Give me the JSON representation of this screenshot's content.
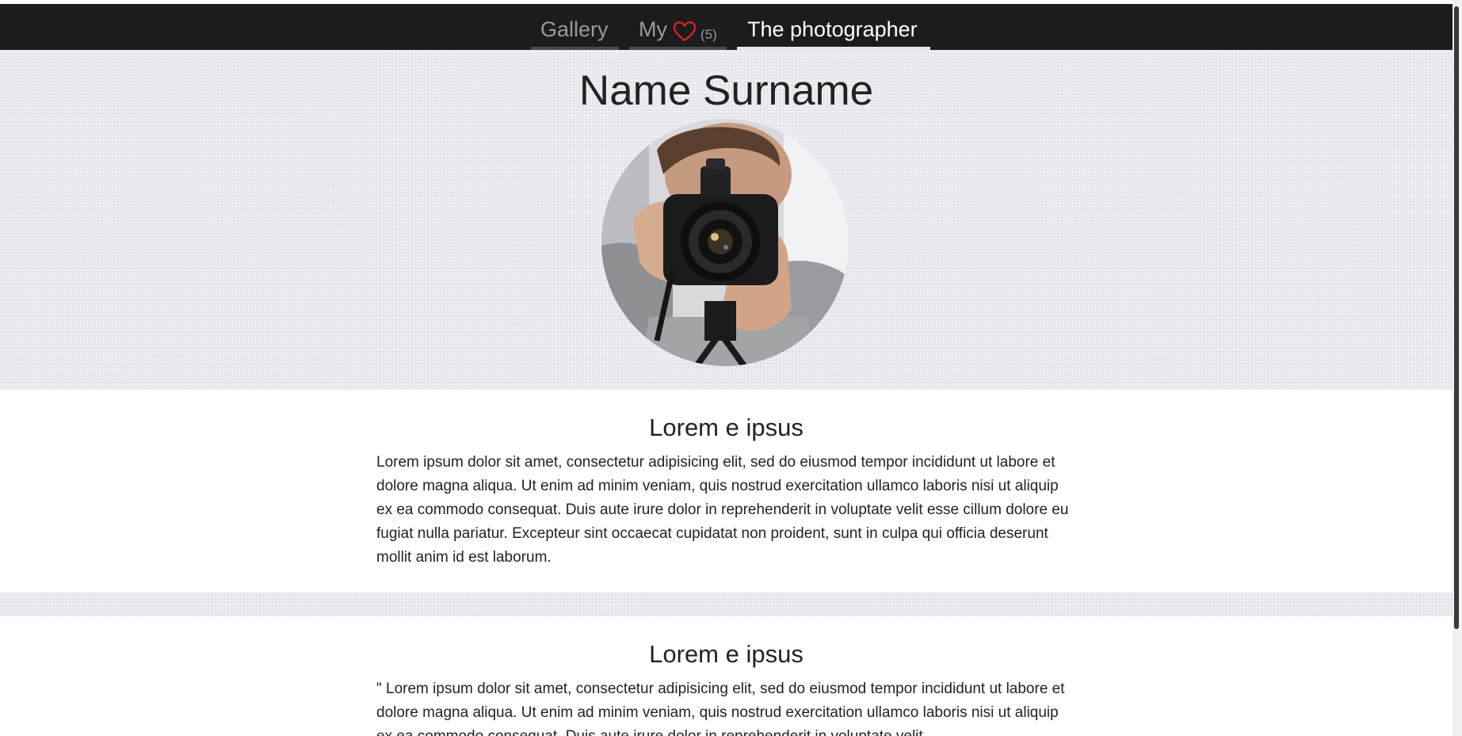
{
  "nav": {
    "items": [
      {
        "label": "Gallery",
        "active": false
      },
      {
        "label": "My",
        "active": false,
        "count": "(5)",
        "icon": "heart-icon"
      },
      {
        "label": "The photographer",
        "active": true
      }
    ]
  },
  "profile": {
    "name": "Name Surname",
    "avatar": "photographer-with-camera"
  },
  "sections": [
    {
      "title": "Lorem e ipsus",
      "text": "Lorem ipsum dolor sit amet, consectetur adipisicing elit, sed do eiusmod tempor incididunt ut labore et dolore magna aliqua. Ut enim ad minim veniam, quis nostrud exercitation ullamco laboris nisi ut aliquip ex ea commodo consequat. Duis aute irure dolor in reprehenderit in voluptate velit esse cillum dolore eu fugiat nulla pariatur. Excepteur sint occaecat cupidatat non proident, sunt in culpa qui officia deserunt mollit anim id est laborum."
    },
    {
      "title": "Lorem e ipsus",
      "text": "\" Lorem ipsum dolor sit amet, consectetur adipisicing elit, sed do eiusmod tempor incididunt ut labore et dolore magna aliqua. Ut enim ad minim veniam, quis nostrud exercitation ullamco laboris nisi ut aliquip ex ea commodo consequat. Duis aute irure dolor in reprehenderit in voluptate velit"
    }
  ],
  "colors": {
    "navbar_bg": "#1c1c1c",
    "nav_active": "#ffffff",
    "nav_inactive": "#9a9a9a",
    "heart": "#e8202a",
    "hero_bg": "#e8e9ee"
  }
}
